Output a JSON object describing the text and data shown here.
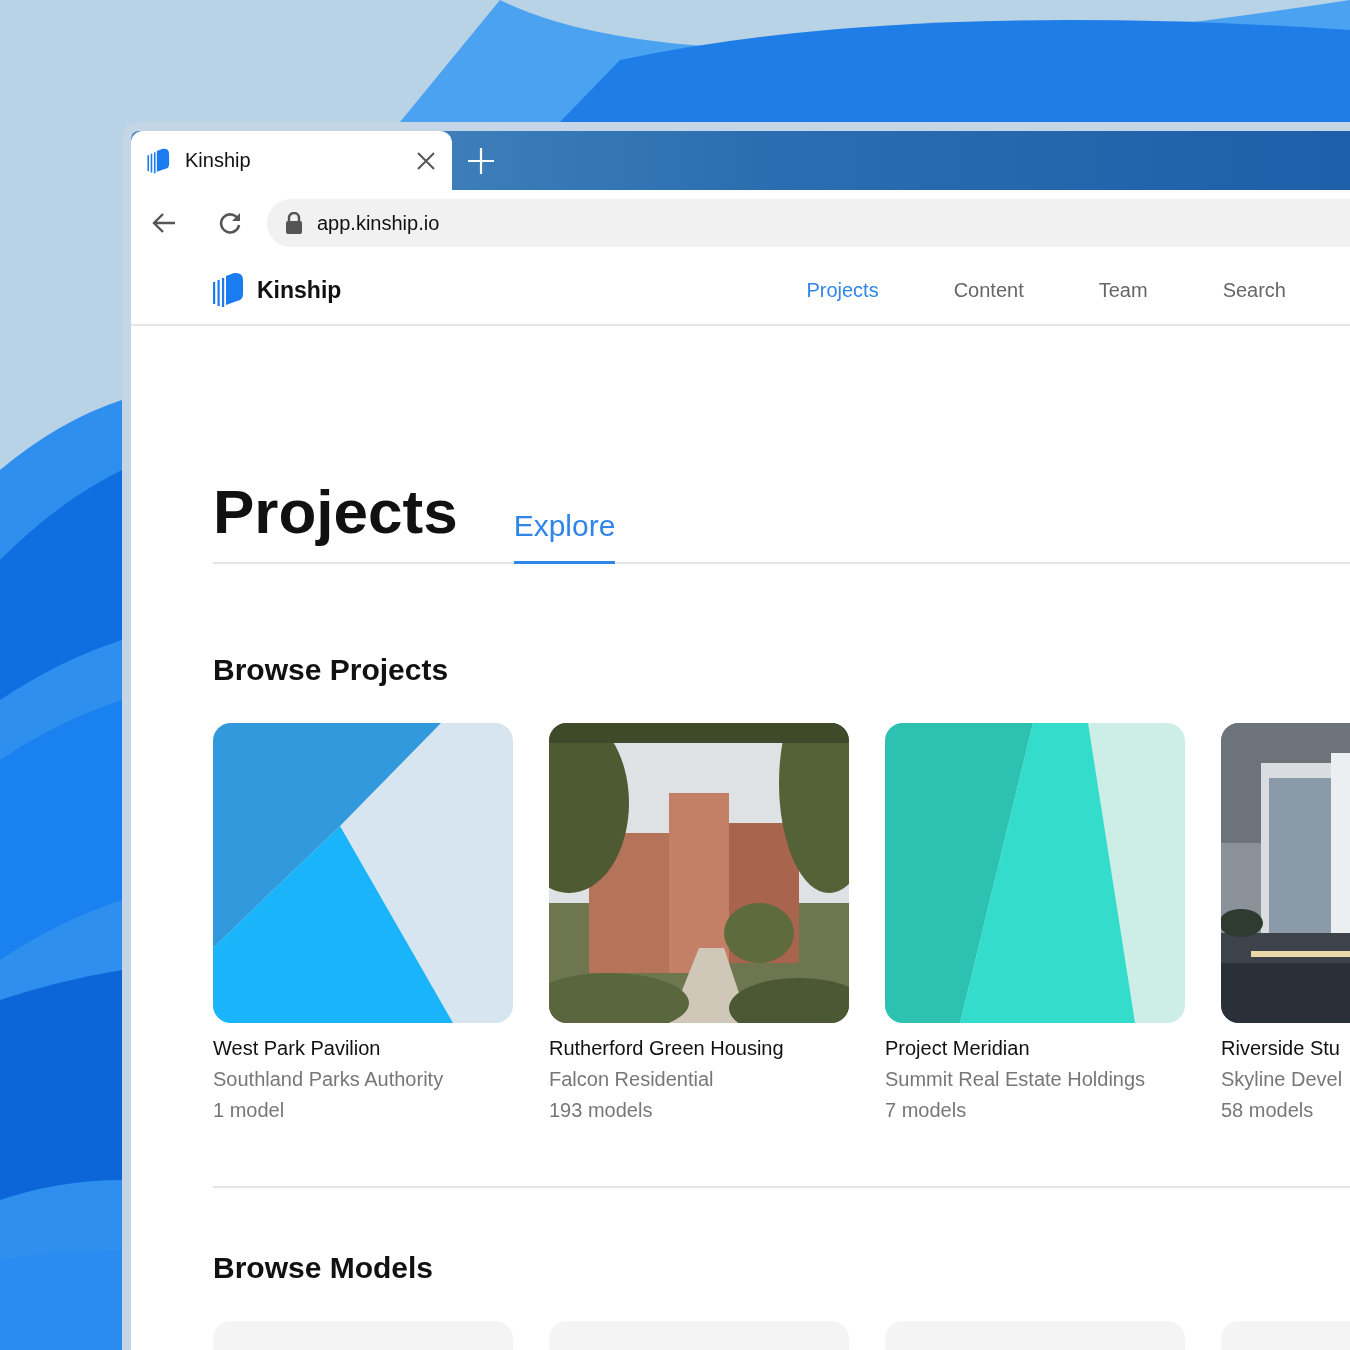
{
  "browser": {
    "tab": {
      "title": "Kinship",
      "selected": true
    },
    "address": "app.kinship.io"
  },
  "app": {
    "brand": "Kinship",
    "nav": [
      {
        "label": "Projects",
        "selected": true
      },
      {
        "label": "Content",
        "selected": false
      },
      {
        "label": "Team",
        "selected": false
      },
      {
        "label": "Search",
        "selected": false
      }
    ]
  },
  "page": {
    "title": "Projects",
    "tabs": [
      {
        "label": "Explore",
        "selected": true
      }
    ]
  },
  "browse_projects": {
    "title": "Browse Projects",
    "projects": [
      {
        "name": "West Park Pavilion",
        "owner": "Southland Parks Authority",
        "models": "1 model",
        "thumbnail": {
          "kind": "angles"
        }
      },
      {
        "name": "Rutherford Green Housing",
        "owner": "Falcon Residential",
        "models": "193 models"
      },
      {
        "name": "Project Meridian",
        "owner": "Summit Real Estate Holdings",
        "models": "7 models",
        "thumbnail": {
          "kind": "stripes"
        }
      },
      {
        "name": "Riverside Stu",
        "owner": "Skyline Devel",
        "models": "58 models"
      }
    ]
  },
  "browse_models": {
    "title": "Browse Models",
    "cards": [
      {
        "kind": "placeholder"
      },
      {
        "kind": "placeholder"
      },
      {
        "kind": "placeholder"
      },
      {
        "kind": "placeholder"
      }
    ]
  }
}
